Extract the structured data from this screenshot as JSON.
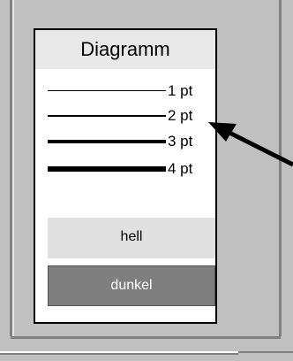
{
  "panel": {
    "title": "Diagramm",
    "line_widths": [
      {
        "label": "1 pt",
        "weight": 1
      },
      {
        "label": "2 pt",
        "weight": 2
      },
      {
        "label": "3 pt",
        "weight": 3
      },
      {
        "label": "4 pt",
        "weight": 4
      }
    ],
    "buttons": {
      "light": "hell",
      "dark": "dunkel"
    }
  },
  "colors": {
    "window_background": "#c0c0c0",
    "panel_background": "#ffffff",
    "title_background": "#e8e8e8",
    "light_button": "#e0e0e0",
    "dark_button": "#7f7f7f",
    "arrow": "#000000"
  },
  "annotation": {
    "icon": "pointer-arrow-icon",
    "points_to": "2 pt"
  }
}
